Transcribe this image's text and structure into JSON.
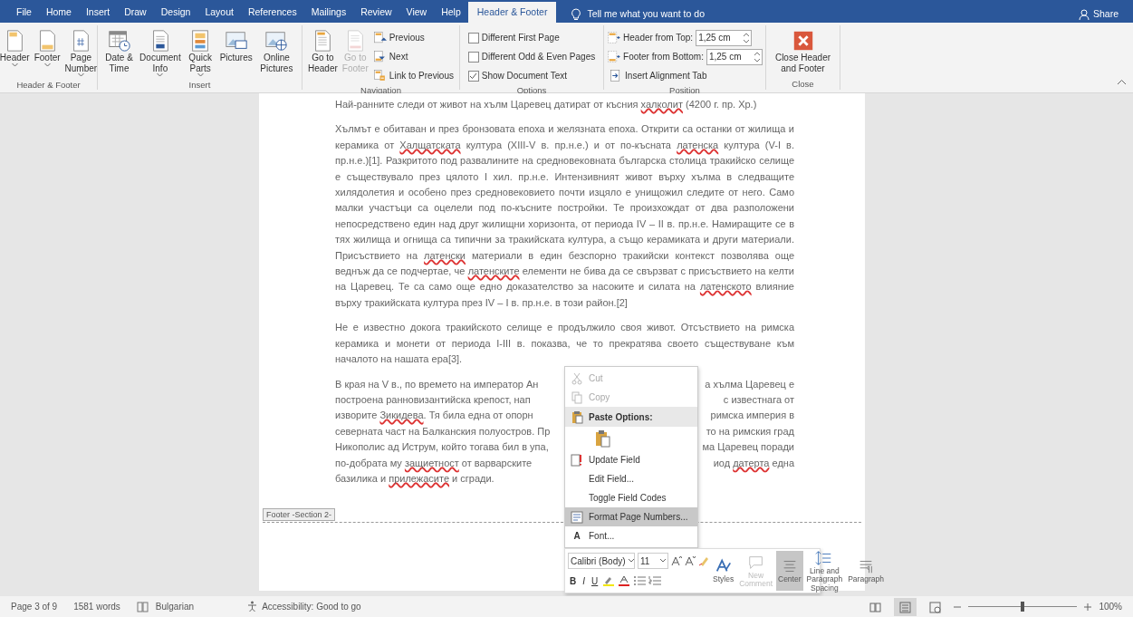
{
  "tabs": [
    {
      "label": "File",
      "selected": false
    },
    {
      "label": "Home",
      "selected": false
    },
    {
      "label": "Insert",
      "selected": false
    },
    {
      "label": "Draw",
      "selected": false
    },
    {
      "label": "Design",
      "selected": false
    },
    {
      "label": "Layout",
      "selected": false
    },
    {
      "label": "References",
      "selected": false
    },
    {
      "label": "Mailings",
      "selected": false
    },
    {
      "label": "Review",
      "selected": false
    },
    {
      "label": "View",
      "selected": false
    },
    {
      "label": "Help",
      "selected": false
    },
    {
      "label": "Header & Footer",
      "selected": true
    }
  ],
  "tell_me": "Tell me what you want to do",
  "share": "Share",
  "ribbon": {
    "groups": [
      {
        "label": "Header & Footer",
        "items": [
          {
            "kind": "large",
            "label": "Header",
            "dropdown": true,
            "disabled": false
          },
          {
            "kind": "large",
            "label": "Footer",
            "dropdown": true,
            "disabled": false
          },
          {
            "kind": "large",
            "label": "Page Number",
            "dropdown": true,
            "disabled": false
          }
        ]
      },
      {
        "label": "Insert",
        "items": [
          {
            "kind": "large",
            "label": "Date & Time",
            "dropdown": false,
            "disabled": false
          },
          {
            "kind": "large",
            "label": "Document Info",
            "dropdown": true,
            "disabled": false
          },
          {
            "kind": "large",
            "label": "Quick Parts",
            "dropdown": true,
            "disabled": false
          },
          {
            "kind": "large",
            "label": "Pictures",
            "dropdown": false,
            "disabled": false
          },
          {
            "kind": "large",
            "label": "Online Pictures",
            "dropdown": false,
            "disabled": false
          }
        ]
      },
      {
        "label": "Navigation",
        "items": [
          {
            "kind": "large",
            "label": "Go to Header",
            "dropdown": false,
            "disabled": false
          },
          {
            "kind": "large",
            "label": "Go to Footer",
            "dropdown": false,
            "disabled": true
          },
          {
            "kind": "small",
            "label": "Previous",
            "disabled": false
          },
          {
            "kind": "small",
            "label": "Next",
            "disabled": false
          },
          {
            "kind": "small",
            "label": "Link to Previous",
            "disabled": false
          }
        ]
      },
      {
        "label": "Options",
        "items": [
          {
            "kind": "check",
            "label": "Different First Page",
            "checked": false
          },
          {
            "kind": "check",
            "label": "Different Odd & Even Pages",
            "checked": false
          },
          {
            "kind": "check",
            "label": "Show Document Text",
            "checked": true
          }
        ]
      },
      {
        "label": "Position",
        "items": [
          {
            "kind": "spin",
            "label": "Header from Top:",
            "value": "1,25 cm"
          },
          {
            "kind": "spin",
            "label": "Footer from Bottom:",
            "value": "1,25 cm"
          },
          {
            "kind": "small",
            "label": "Insert Alignment Tab",
            "disabled": false
          }
        ]
      },
      {
        "label": "Close",
        "items": [
          {
            "kind": "large",
            "label": "Close Header and Footer",
            "dropdown": false,
            "disabled": false
          }
        ]
      }
    ]
  },
  "document": {
    "paragraphs": [
      {
        "kind": "flow",
        "runs": [
          {
            "text": "Най-ранните следи от живот на хълм Царевец датират от късния ",
            "misspelled": false
          },
          {
            "text": "халколит",
            "misspelled": true
          },
          {
            "text": " (4200 г. пр. Хр.)",
            "misspelled": false
          }
        ]
      },
      {
        "kind": "flow",
        "runs": [
          {
            "text": "Хълмът е обитаван и през бронзовата епоха и желязната епоха. Открити са останки от жилища и керамика от ",
            "misspelled": false
          },
          {
            "text": "Халщатската",
            "misspelled": true
          },
          {
            "text": " култура (XIII-V в. пр.н.е.) и от по-късната ",
            "misspelled": false
          },
          {
            "text": "латенска",
            "misspelled": true
          },
          {
            "text": " култура (V-I в. пр.н.е.)[1]. Разкритото под развалините на средновековната българска столица тракийско селище е съществувало през цялото I хил. пр.н.е. Интензивният живот върху хълма в следващите хилядолетия и особено през средновековието почти изцяло е унищожил следите от него. Само малки участъци са оцелели под по-късните постройки. Те произхождат от два разположени непосредствено един над друг жилищни хоризонта, от периода IV – II в. пр.н.е. Намиращите се в тях жилища и огнища са типични за тракийската култура, а също керамиката и други материали. Присъствието на ",
            "misspelled": false
          },
          {
            "text": "латенски",
            "misspelled": true
          },
          {
            "text": " материали в един безспорно тракийски контекст позволява още веднъж да се подчертае, че ",
            "misspelled": false
          },
          {
            "text": "латенските",
            "misspelled": true
          },
          {
            "text": " елементи не бива да се свързват с присъствието на келти на Царевец. Те са само още едно доказателство за насоките и силата на ",
            "misspelled": false
          },
          {
            "text": "латенското",
            "misspelled": true
          },
          {
            "text": " влияние върху тракийската култура през IV – I в. пр.н.е. в този район.[2]",
            "misspelled": false
          }
        ]
      },
      {
        "kind": "flow",
        "runs": [
          {
            "text": "Не е известно докога тракийското селище е продължило своя живот. Отсъствието на римска керамика и монети от периода I-III в. показва, че то прекратява своето съществуване към началото на нашата ера[3].",
            "misspelled": false
          }
        ]
      },
      {
        "kind": "split",
        "lines": [
          {
            "left": [
              {
                "text": "В края на V в., по времето на император Ан",
                "misspelled": false
              }
            ],
            "right": [
              {
                "text": "а хълма Царевец е",
                "misspelled": false
              }
            ]
          },
          {
            "left": [
              {
                "text": "построена ранновизантийска крепост, нап",
                "misspelled": false
              }
            ],
            "right": [
              {
                "text": "с известнага от",
                "misspelled": false
              }
            ]
          },
          {
            "left": [
              {
                "text": "изворите ",
                "misspelled": false
              },
              {
                "text": "Зикидева",
                "misspelled": true
              },
              {
                "text": ". Тя била една от опорн",
                "misspelled": false
              }
            ],
            "right": [
              {
                "text": "римска империя в",
                "misspelled": false
              }
            ]
          },
          {
            "left": [
              {
                "text": "северната част на Балканския полуостров. Пр",
                "misspelled": false
              }
            ],
            "right": [
              {
                "text": "то на римския град",
                "misspelled": false
              }
            ]
          },
          {
            "left": [
              {
                "text": "Никополис ад Иструм, който тогава бил в упа,",
                "misspelled": false
              }
            ],
            "right": [
              {
                "text": "ма Царевец поради",
                "misspelled": false
              }
            ]
          },
          {
            "left": [
              {
                "text": "по-добрата му ",
                "misspelled": false
              },
              {
                "text": "защиетност",
                "misspelled": true
              },
              {
                "text": " от варварските",
                "misspelled": false
              }
            ],
            "right": [
              {
                "text": "иод ",
                "misspelled": false
              },
              {
                "text": "датерта",
                "misspelled": true
              },
              {
                "text": " една",
                "misspelled": false
              }
            ]
          },
          {
            "left": [
              {
                "text": "базилика и ",
                "misspelled": false
              },
              {
                "text": "прилежасите",
                "misspelled": true
              },
              {
                "text": " и сгради.",
                "misspelled": false
              }
            ]
          }
        ]
      }
    ],
    "footer_tag": "Footer -Section 2-"
  },
  "context_menu": {
    "items": [
      {
        "kind": "item",
        "label": "Cut",
        "disabled": true,
        "selected": false
      },
      {
        "kind": "item",
        "label": "Copy",
        "disabled": true,
        "selected": false
      },
      {
        "kind": "header",
        "label": "Paste Options:"
      },
      {
        "kind": "paste"
      },
      {
        "kind": "item",
        "label": "Update Field",
        "disabled": false,
        "selected": false
      },
      {
        "kind": "item",
        "label": "Edit Field...",
        "disabled": false,
        "selected": false
      },
      {
        "kind": "item",
        "label": "Toggle Field Codes",
        "disabled": false,
        "selected": false
      },
      {
        "kind": "item",
        "label": "Format Page Numbers...",
        "disabled": false,
        "selected": true
      },
      {
        "kind": "item",
        "label": "Font...",
        "glyph": "A",
        "disabled": false,
        "selected": false
      }
    ]
  },
  "mini_toolbar": {
    "font": "Calibri (Body)",
    "size": "11",
    "style_buttons": [
      "B",
      "I",
      "U"
    ],
    "buttons": [
      {
        "label": "Styles",
        "disabled": false,
        "selected": false
      },
      {
        "label": "New Comment",
        "disabled": true,
        "selected": false
      },
      {
        "label": "Center",
        "disabled": false,
        "selected": true
      },
      {
        "label": "Line and Paragraph Spacing",
        "disabled": false,
        "selected": false
      },
      {
        "label": "Paragraph",
        "disabled": false,
        "selected": false
      }
    ]
  },
  "status_bar": {
    "page": "Page 3 of 9",
    "words": "1581 words",
    "language": "Bulgarian",
    "accessibility": "Accessibility: Good to go",
    "views": [
      {
        "selected": false
      },
      {
        "selected": true
      },
      {
        "selected": false
      }
    ],
    "zoom": {
      "level": 0.5,
      "reading": "100%"
    }
  }
}
